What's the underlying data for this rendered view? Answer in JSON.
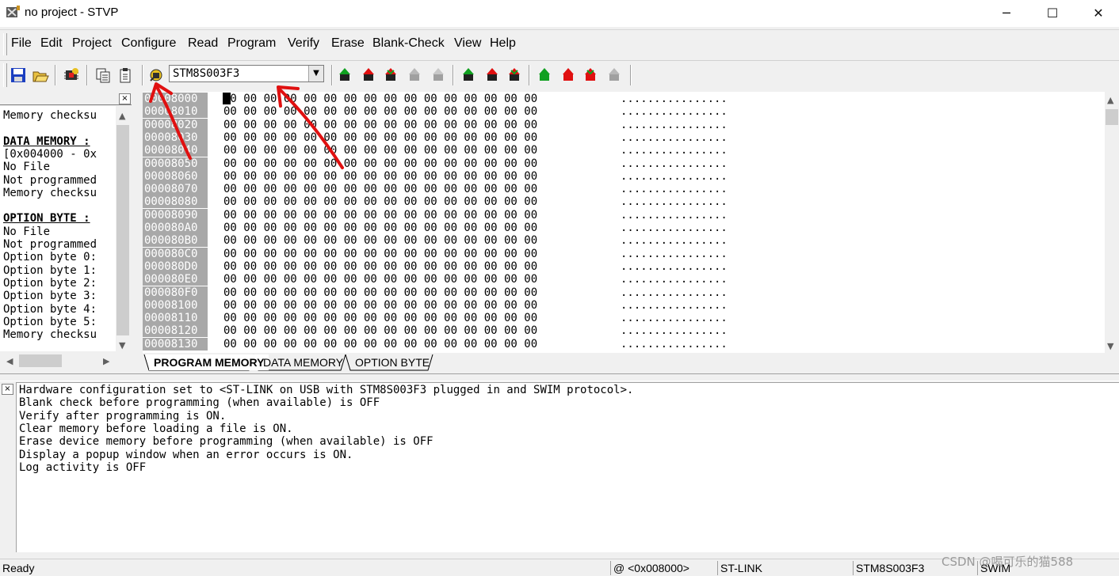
{
  "window": {
    "title": "no project - STVP",
    "controls": {
      "minimize": "─",
      "maximize": "☐",
      "close": "✕"
    }
  },
  "menu": [
    "File",
    "Edit",
    "Project",
    "Configure",
    "Read",
    "Program",
    "Verify",
    "Erase",
    "Blank-Check",
    "View",
    "Help"
  ],
  "toolbar": {
    "device": "STM8S003F3",
    "icons": [
      "save-icon",
      "open-icon",
      "chip-config-icon",
      "copy-icon",
      "paste-icon",
      "configure-icon",
      "read-all-icon",
      "program-all-icon",
      "verify-all-icon",
      "erase-icon",
      "blank-check-icon",
      "read-current-icon",
      "program-current-icon",
      "verify-current-icon",
      "read-option-icon",
      "program-option-icon",
      "verify-option-icon",
      "erase-option-icon"
    ]
  },
  "left_panel": {
    "lines": [
      {
        "text": "Memory checksu",
        "bold": false
      },
      {
        "text": "",
        "bold": false
      },
      {
        "text": "DATA MEMORY :",
        "bold": true
      },
      {
        "text": "[0x004000 - 0x",
        "bold": false
      },
      {
        "text": "No File",
        "bold": false
      },
      {
        "text": "Not programmed",
        "bold": false
      },
      {
        "text": "Memory checksu",
        "bold": false
      },
      {
        "text": "",
        "bold": false
      },
      {
        "text": "OPTION BYTE :",
        "bold": true
      },
      {
        "text": "No File",
        "bold": false
      },
      {
        "text": "Not programmed",
        "bold": false
      },
      {
        "text": "Option byte 0:",
        "bold": false
      },
      {
        "text": "Option byte 1:",
        "bold": false
      },
      {
        "text": "Option byte 2:",
        "bold": false
      },
      {
        "text": "Option byte 3:",
        "bold": false
      },
      {
        "text": "Option byte 4:",
        "bold": false
      },
      {
        "text": "Option byte 5:",
        "bold": false
      },
      {
        "text": "Memory checksu",
        "bold": false
      }
    ]
  },
  "memory": {
    "addresses": [
      "00008000",
      "00008010",
      "00008020",
      "00008030",
      "00008040",
      "00008050",
      "00008060",
      "00008070",
      "00008080",
      "00008090",
      "000080A0",
      "000080B0",
      "000080C0",
      "000080D0",
      "000080E0",
      "000080F0",
      "00008100",
      "00008110",
      "00008120",
      "00008130"
    ],
    "hex_row": "00 00 00 00 00 00 00 00 00 00 00 00 00 00 00 00",
    "ascii_row": "................"
  },
  "tabs": [
    "PROGRAM MEMORY",
    "DATA MEMORY",
    "OPTION BYTE"
  ],
  "log": [
    "Hardware configuration set to <ST-LINK on USB with STM8S003F3 plugged in and SWIM protocol>.",
    "Blank check before programming (when available) is OFF",
    "Verify after programming is ON.",
    "Clear memory before loading a file is ON.",
    "Erase device memory before programming (when available) is OFF",
    "Display a popup window when an error occurs is ON.",
    "Log activity is OFF"
  ],
  "status": {
    "ready": "Ready",
    "address": "@ <0x008000>",
    "probe": "ST-LINK",
    "device": "STM8S003F3",
    "protocol": "SWIM"
  },
  "watermark": "CSDN @喝可乐的猫588",
  "colors": {
    "annotation": "#e01010",
    "address_bg": "#a8a8a8"
  }
}
